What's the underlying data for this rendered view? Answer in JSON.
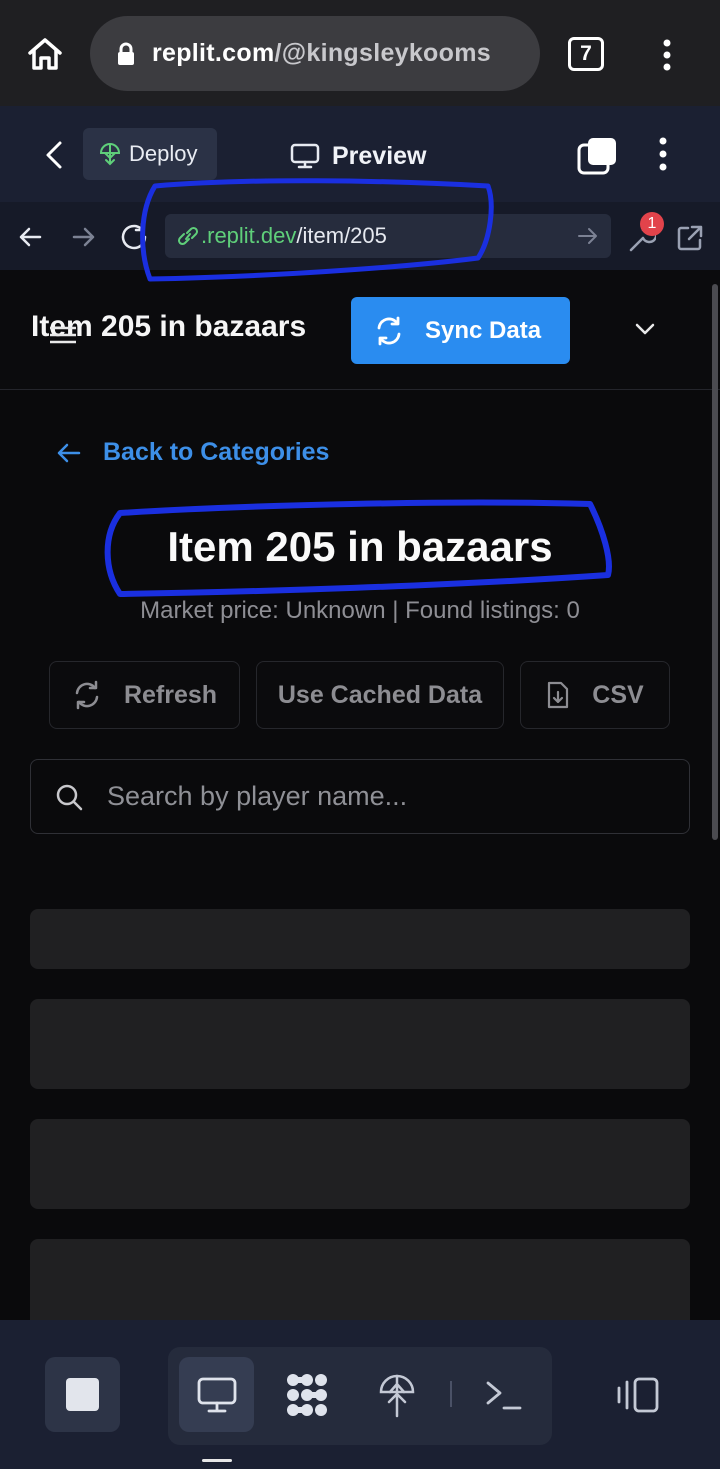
{
  "browser": {
    "url_host": "replit.com",
    "url_path": "/@kingsleykooms",
    "tab_count": "7"
  },
  "replit": {
    "deploy_label": "Deploy",
    "preview_label": "Preview",
    "preview_url_domain": ".replit.dev",
    "preview_url_path": "/item/205",
    "notification_count": "1"
  },
  "app": {
    "header_title": "Item 205 in bazaars",
    "sync_label": "Sync Data",
    "back_label": "Back to Categories",
    "item_title": "Item 205 in bazaars",
    "market_line": "Market price: Unknown | Found listings: 0",
    "refresh_label": "Refresh",
    "cached_label": "Use Cached Data",
    "csv_label": "CSV",
    "search_placeholder": "Search by player name..."
  },
  "colors": {
    "accent": "#2a8cf0",
    "link": "#3d8fe8",
    "annotation_ink": "#1a2fe0"
  }
}
